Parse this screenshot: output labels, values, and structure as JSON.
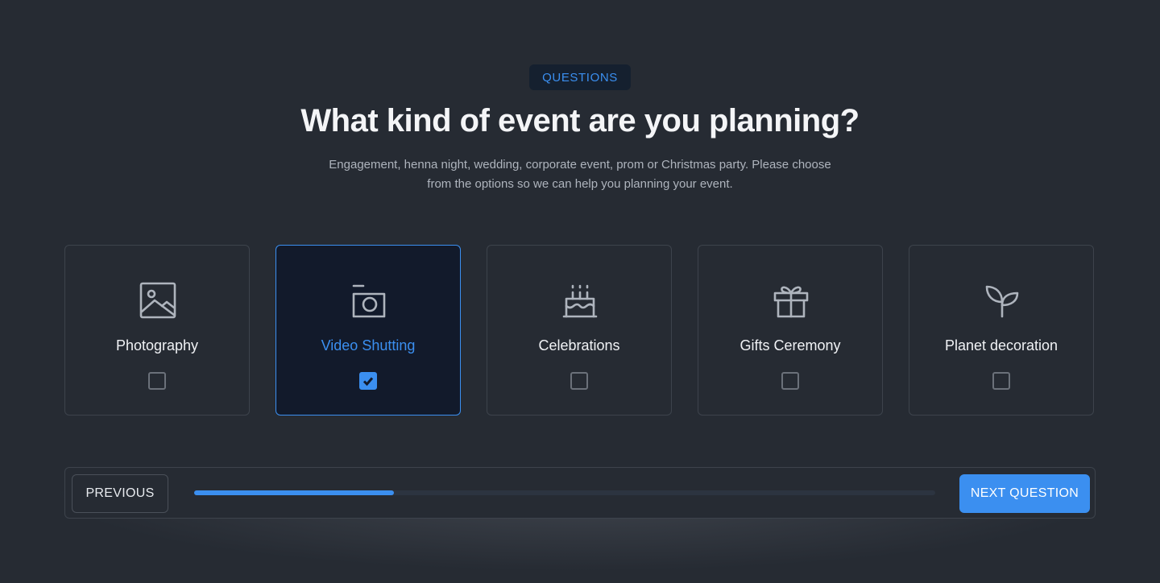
{
  "badge": "QUESTIONS",
  "title": "What kind of event are you planning?",
  "subtitle_line1": "Engagement, henna night, wedding, corporate event, prom or Christmas party. Please choose",
  "subtitle_line2": "from the options so we can help you planning your event.",
  "options": [
    {
      "label": "Photography",
      "icon": "image-icon",
      "checked": false
    },
    {
      "label": "Video Shutting",
      "icon": "camera-icon",
      "checked": true
    },
    {
      "label": "Celebrations",
      "icon": "cake-icon",
      "checked": false
    },
    {
      "label": "Gifts Ceremony",
      "icon": "gift-icon",
      "checked": false
    },
    {
      "label": "Planet decoration",
      "icon": "plant-icon",
      "checked": false
    }
  ],
  "footer": {
    "previous_label": "PREVIOUS",
    "next_label": "NEXT QUESTION",
    "progress": 0.27
  },
  "colors": {
    "accent": "#3b8ff0",
    "background": "#262b33",
    "selected_card": "#121a2b"
  }
}
